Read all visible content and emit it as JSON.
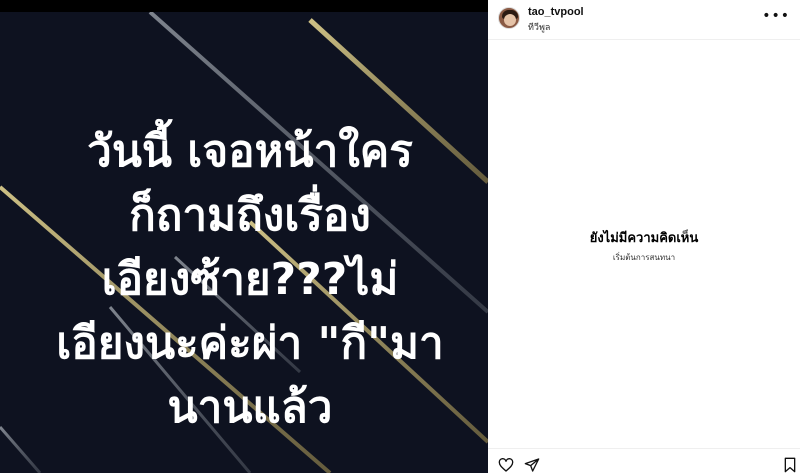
{
  "post": {
    "text_lines": [
      "วันนี้ เจอหน้าใคร",
      "ก็ถามถึงเรื่อง",
      "เอียงซ้าย???ไม่",
      "เอียงนะค่ะผ่า \"กี\"มา",
      "นานแล้ว"
    ]
  },
  "header": {
    "username": "tao_tvpool",
    "location": "ทีวีพูล",
    "more_icon": "more-horizontal-icon"
  },
  "comments": {
    "empty_title": "ยังไม่มีความคิดเห็น",
    "empty_subtitle": "เริ่มต้นการสนทนา"
  },
  "actions": {
    "like_icon": "heart-icon",
    "share_icon": "send-icon",
    "save_icon": "bookmark-icon"
  }
}
